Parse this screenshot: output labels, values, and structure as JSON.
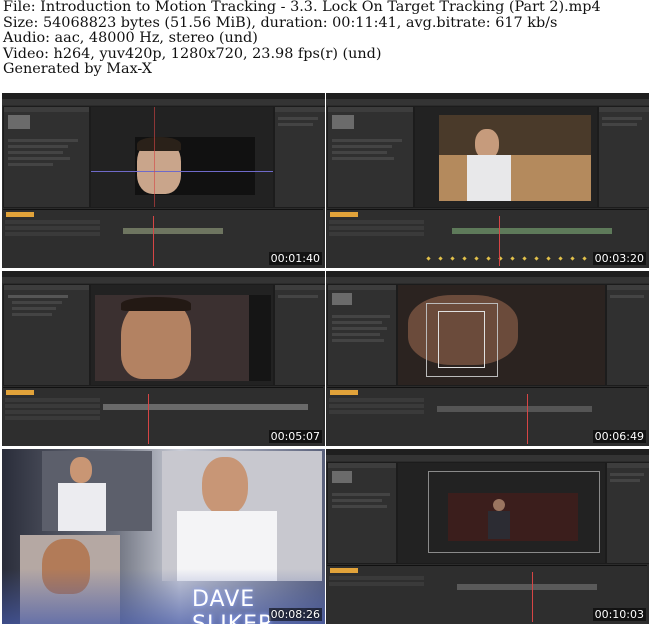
{
  "header": {
    "line1": "File: Introduction to Motion Tracking - 3.3. Lock On Target Tracking (Part 2).mp4",
    "line2": "Size: 54068823 bytes (51.56 MiB), duration: 00:11:41, avg.bitrate: 617 kb/s",
    "line3": "Audio: aac, 48000 Hz, stereo (und)",
    "line4": "Video: h264, yuv420p, 1280x720, 23.98 fps(r) (und)",
    "line5": "Generated by Max-X"
  },
  "thumbnails": [
    {
      "timestamp": "00:01:40",
      "scene": "after-effects-face-preview"
    },
    {
      "timestamp": "00:03:20",
      "scene": "after-effects-speaker-preview"
    },
    {
      "timestamp": "00:05:07",
      "scene": "after-effects-profile-closeup"
    },
    {
      "timestamp": "00:06:49",
      "scene": "after-effects-tracking-box"
    },
    {
      "timestamp": "00:08:26",
      "scene": "title-card",
      "overlay_text": "DAVE SLIKER"
    },
    {
      "timestamp": "00:10:03",
      "scene": "after-effects-stage-preview"
    }
  ]
}
